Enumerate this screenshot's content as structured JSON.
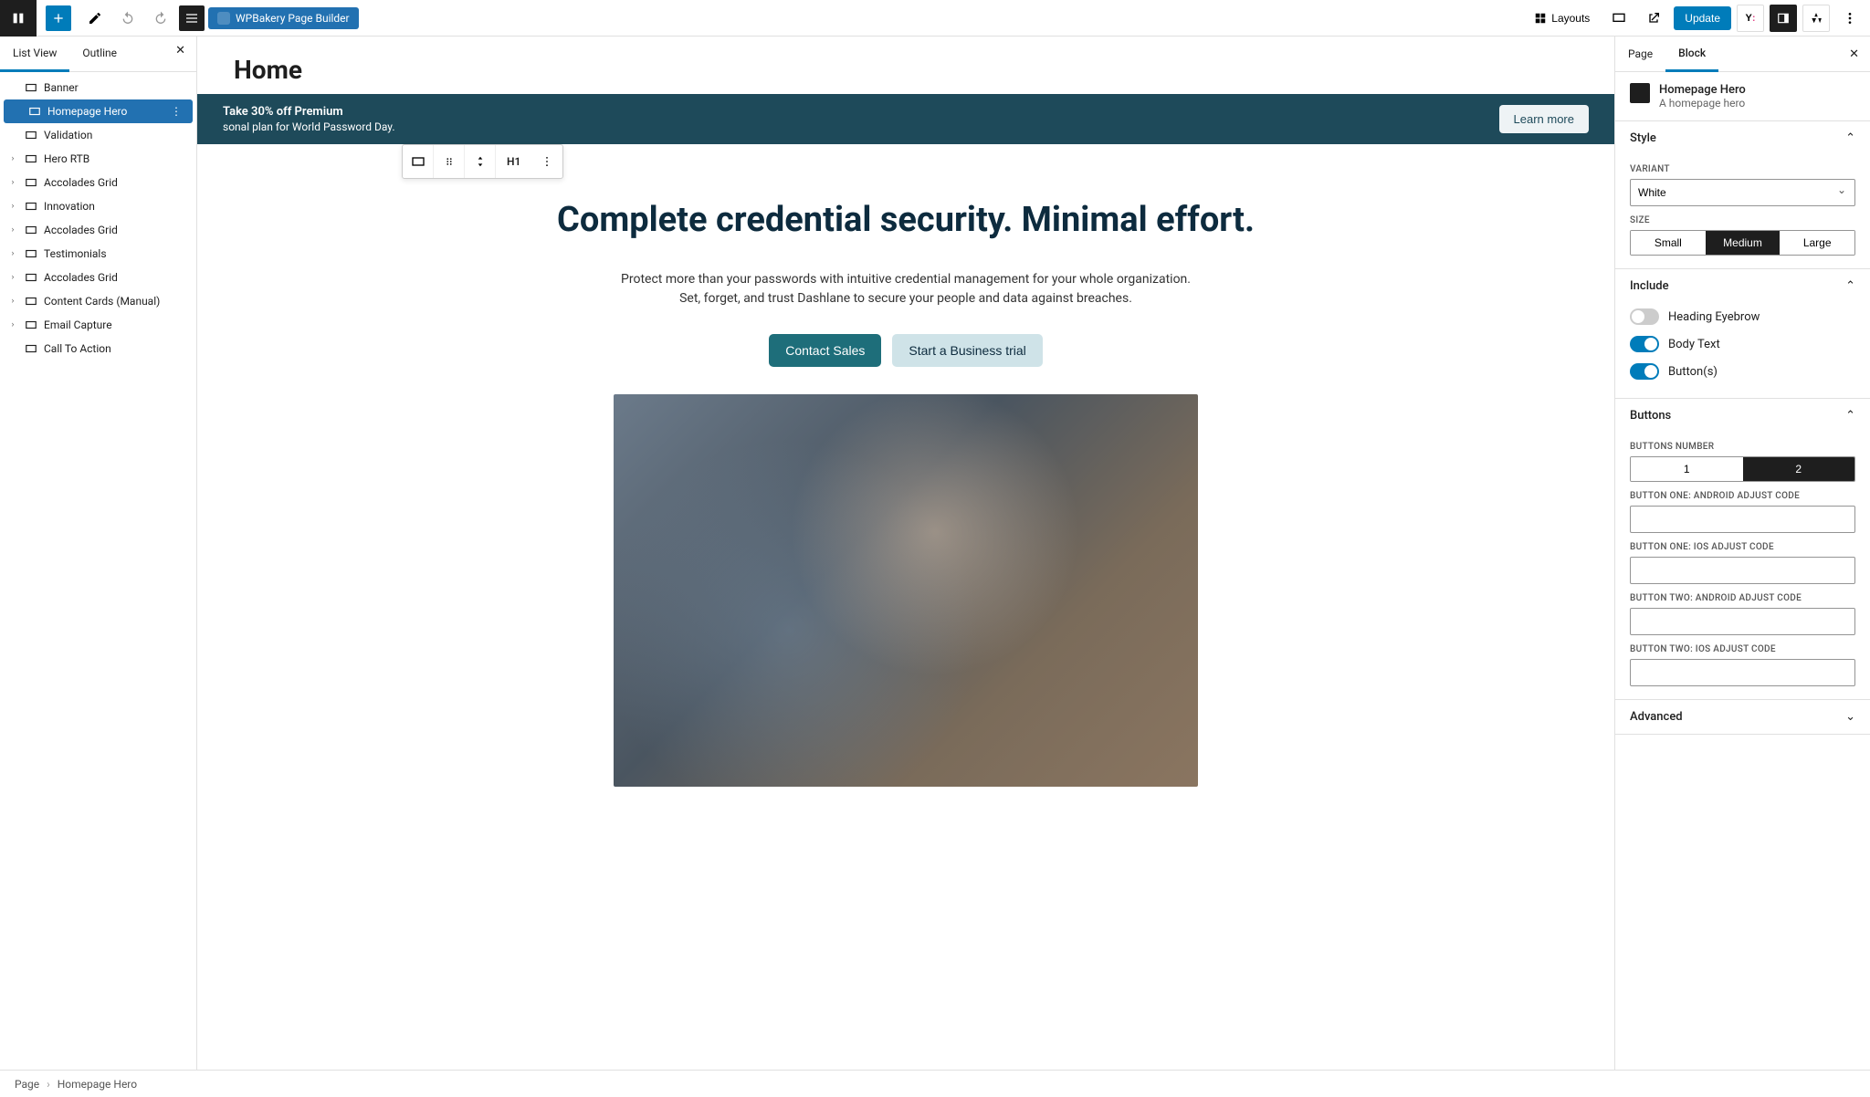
{
  "topbar": {
    "wpbakery": "WPBakery Page Builder",
    "layouts": "Layouts",
    "update": "Update"
  },
  "leftPanel": {
    "tabs": {
      "listView": "List View",
      "outline": "Outline"
    },
    "items": [
      {
        "label": "Banner",
        "caret": false
      },
      {
        "label": "Homepage Hero",
        "caret": false,
        "selected": true
      },
      {
        "label": "Validation",
        "caret": false
      },
      {
        "label": "Hero RTB",
        "caret": true
      },
      {
        "label": "Accolades Grid",
        "caret": true
      },
      {
        "label": "Innovation",
        "caret": true
      },
      {
        "label": "Accolades Grid",
        "caret": true
      },
      {
        "label": "Testimonials",
        "caret": true
      },
      {
        "label": "Accolades Grid",
        "caret": true
      },
      {
        "label": "Content Cards (Manual)",
        "caret": true
      },
      {
        "label": "Email Capture",
        "caret": true
      },
      {
        "label": "Call To Action",
        "caret": false
      }
    ]
  },
  "canvas": {
    "pageTitle": "Home",
    "promo": {
      "title": "Take 30% off Premium",
      "sub": "sonal plan for World Password Day.",
      "cta": "Learn more"
    },
    "floatingH": "H1",
    "hero": {
      "heading": "Complete credential security. Minimal effort.",
      "body": "Protect more than your passwords with intuitive credential management for your whole organization. Set, forget, and trust Dashlane to secure your people and data against breaches.",
      "btn1": "Contact Sales",
      "btn2": "Start a Business trial"
    }
  },
  "rightPanel": {
    "tabs": {
      "page": "Page",
      "block": "Block"
    },
    "blockName": "Homepage Hero",
    "blockDesc": "A homepage hero",
    "sections": {
      "style": "Style",
      "include": "Include",
      "buttons": "Buttons",
      "advanced": "Advanced"
    },
    "variantLabel": "VARIANT",
    "variantValue": "White",
    "sizeLabel": "SIZE",
    "sizeOptions": {
      "small": "Small",
      "medium": "Medium",
      "large": "Large"
    },
    "includeToggles": {
      "eyebrow": "Heading Eyebrow",
      "body": "Body Text",
      "buttons": "Button(s)"
    },
    "buttonsNumberLabel": "BUTTONS NUMBER",
    "buttonsNumberOptions": {
      "one": "1",
      "two": "2"
    },
    "fieldLabels": {
      "b1a": "BUTTON ONE: ANDROID ADJUST CODE",
      "b1i": "BUTTON ONE: IOS ADJUST CODE",
      "b2a": "BUTTON TWO: ANDROID ADJUST CODE",
      "b2i": "BUTTON TWO: IOS ADJUST CODE"
    }
  },
  "footer": {
    "page": "Page",
    "crumb": "Homepage Hero"
  }
}
